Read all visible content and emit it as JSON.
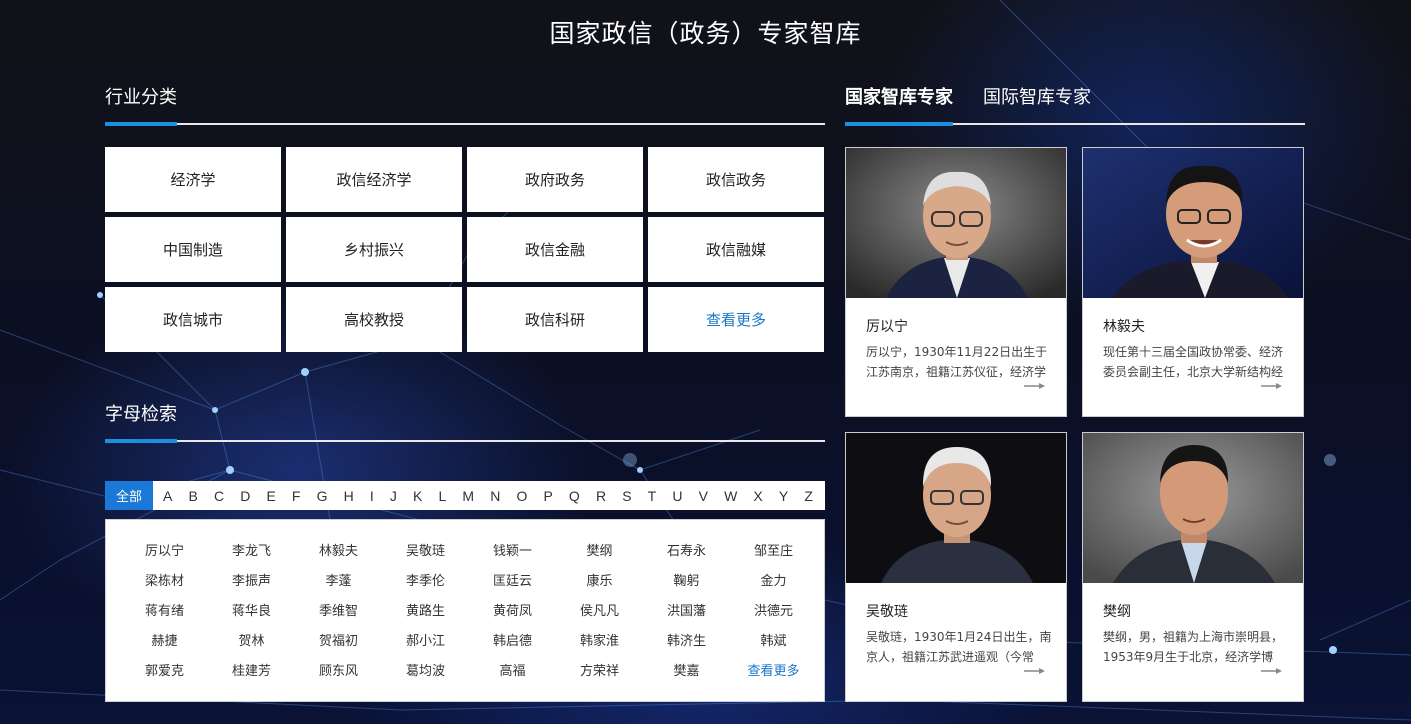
{
  "page": {
    "title": "国家政信（政务）专家智库"
  },
  "industry": {
    "heading": "行业分类",
    "items": [
      "经济学",
      "政信经济学",
      "政府政务",
      "政信政务",
      "中国制造",
      "乡村振兴",
      "政信金融",
      "政信融媒",
      "政信城市",
      "高校教授",
      "政信科研",
      "查看更多"
    ]
  },
  "letters": {
    "heading": "字母检索",
    "all_label": "全部",
    "alphabet": [
      "A",
      "B",
      "C",
      "D",
      "E",
      "F",
      "G",
      "H",
      "I",
      "J",
      "K",
      "L",
      "M",
      "N",
      "O",
      "P",
      "Q",
      "R",
      "S",
      "T",
      "U",
      "V",
      "W",
      "X",
      "Y",
      "Z"
    ],
    "names": [
      "厉以宁",
      "李龙飞",
      "林毅夫",
      "吴敬琏",
      "钱颖一",
      "樊纲",
      "石寿永",
      "邹至庄",
      "梁栋材",
      "李振声",
      "李蓬",
      "李季伦",
      "匡廷云",
      "康乐",
      "鞠躬",
      "金力",
      "蒋有绪",
      "蒋华良",
      "季维智",
      "黄路生",
      "黄荷凤",
      "侯凡凡",
      "洪国藩",
      "洪德元",
      "赫捷",
      "贺林",
      "贺福初",
      "郝小江",
      "韩启德",
      "韩家淮",
      "韩济生",
      "韩斌",
      "郭爱克",
      "桂建芳",
      "顾东风",
      "葛均波",
      "高福",
      "方荣祥",
      "樊嘉",
      "查看更多"
    ]
  },
  "experts": {
    "tabs": [
      "国家智库专家",
      "国际智库专家"
    ],
    "active_tab": 0,
    "cards": [
      {
        "name": "厉以宁",
        "desc": "厉以宁，1930年11月22日出生于江苏南京，祖籍江苏仪征，经济学"
      },
      {
        "name": "林毅夫",
        "desc": "现任第十三届全国政协常委、经济委员会副主任，北京大学新结构经"
      },
      {
        "name": "吴敬琏",
        "desc": "吴敬琏，1930年1月24日出生，南京人，祖籍江苏武进遥观（今常"
      },
      {
        "name": "樊纲",
        "desc": "樊纲，男，祖籍为上海市崇明县，1953年9月生于北京，经济学博"
      }
    ]
  },
  "colors": {
    "accent": "#1c8fe0",
    "link": "#1a78c8",
    "alpha_active": "#1c78d6"
  }
}
